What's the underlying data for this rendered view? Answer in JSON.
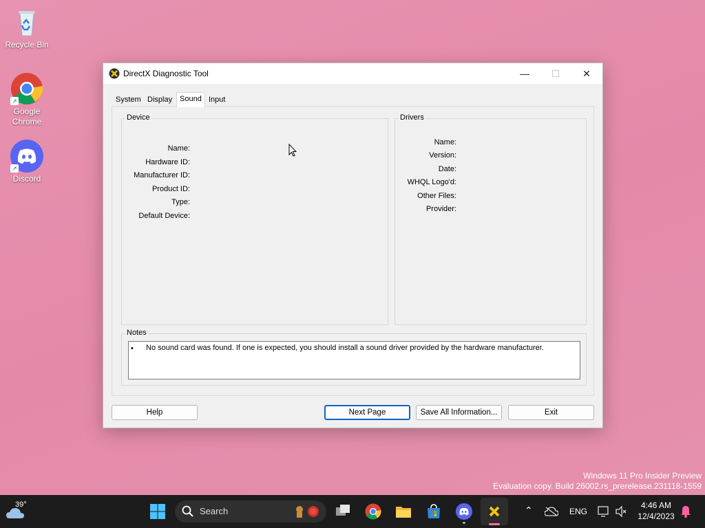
{
  "desktop": {
    "icons": [
      {
        "label": "Recycle Bin"
      },
      {
        "label": "Google Chrome"
      },
      {
        "label": "Discord"
      }
    ],
    "watermark": {
      "line1": "Windows 11 Pro Insider Preview",
      "line2": "Evaluation copy. Build 26002.rs_prerelease.231118-1559"
    }
  },
  "window": {
    "title": "DirectX Diagnostic Tool",
    "controls": {
      "minimize": "—",
      "maximize": "☐",
      "close": "✕"
    },
    "tabs": [
      {
        "label": "System"
      },
      {
        "label": "Display"
      },
      {
        "label": "Sound",
        "active": true
      },
      {
        "label": "Input"
      }
    ],
    "device": {
      "title": "Device",
      "fields": [
        "Name:",
        "Hardware ID:",
        "Manufacturer ID:",
        "Product ID:",
        "Type:",
        "Default Device:"
      ]
    },
    "drivers": {
      "title": "Drivers",
      "fields": [
        "Name:",
        "Version:",
        "Date:",
        "WHQL Logo'd:",
        "Other Files:",
        "Provider:"
      ]
    },
    "notes": {
      "title": "Notes",
      "items": [
        "No sound card was found.  If one is expected, you should install a sound driver provided by the hardware manufacturer."
      ]
    },
    "buttons": {
      "help": "Help",
      "next_page": "Next Page",
      "save_all": "Save All Information...",
      "exit": "Exit"
    }
  },
  "taskbar": {
    "weather": {
      "temp": "39°"
    },
    "search": {
      "label": "Search"
    },
    "tray": {
      "language": "ENG",
      "time": "4:46 AM",
      "date": "12/4/2023"
    }
  },
  "colors": {
    "desktop_bg": "#e48aa9",
    "taskbar_bg": "#1c1c1c",
    "accent": "#0a64c2",
    "window_bg": "#f0f0f0"
  }
}
